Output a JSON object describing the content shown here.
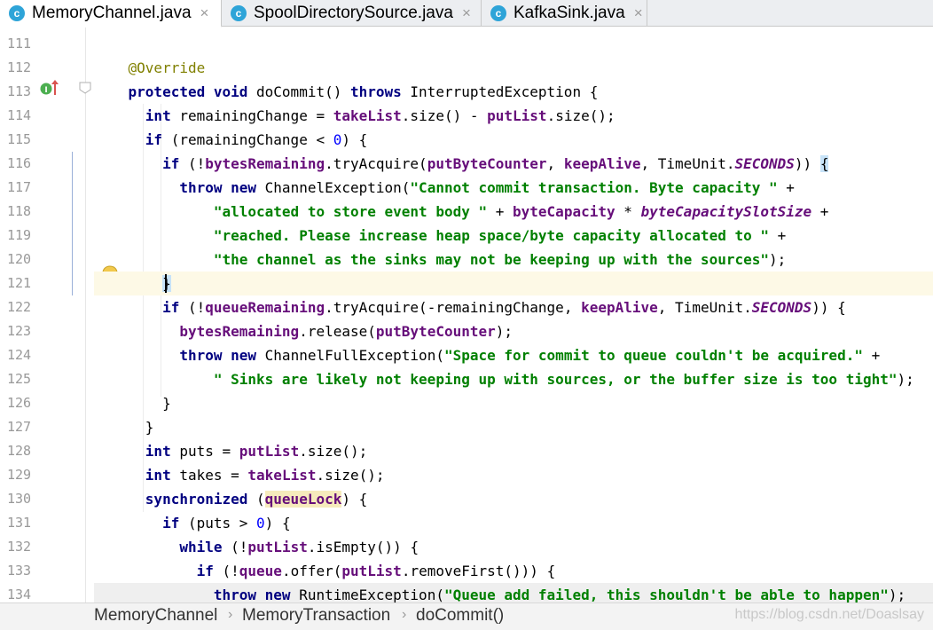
{
  "tabs": [
    {
      "label": "MemoryChannel.java",
      "active": true,
      "close": "×"
    },
    {
      "label": "SpoolDirectorySource.java",
      "active": false,
      "close": "×"
    },
    {
      "label": "KafkaSink.java",
      "active": false,
      "close": "×"
    }
  ],
  "tab_icon_letter": "c",
  "editor": {
    "line_numbers": [
      "111",
      "112",
      "113",
      "114",
      "115",
      "116",
      "117",
      "118",
      "119",
      "120",
      "121",
      "122",
      "123",
      "124",
      "125",
      "126",
      "127",
      "128",
      "129",
      "130",
      "131",
      "132",
      "133",
      "134"
    ],
    "lines": [
      [],
      [
        {
          "t": "    "
        },
        {
          "t": "@Override",
          "c": "ann"
        }
      ],
      [
        {
          "t": "    "
        },
        {
          "t": "protected void",
          "c": "kw"
        },
        {
          "t": " doCommit() "
        },
        {
          "t": "throws",
          "c": "kw"
        },
        {
          "t": " InterruptedException {"
        }
      ],
      [
        {
          "t": "      "
        },
        {
          "t": "int",
          "c": "kw"
        },
        {
          "t": " remainingChange = "
        },
        {
          "t": "takeList",
          "c": "fld"
        },
        {
          "t": ".size() - "
        },
        {
          "t": "putList",
          "c": "fld"
        },
        {
          "t": ".size();"
        }
      ],
      [
        {
          "t": "      "
        },
        {
          "t": "if",
          "c": "kw"
        },
        {
          "t": " (remainingChange < "
        },
        {
          "t": "0",
          "c": "num"
        },
        {
          "t": ") {"
        }
      ],
      [
        {
          "t": "        "
        },
        {
          "t": "if",
          "c": "kw"
        },
        {
          "t": " (!"
        },
        {
          "t": "bytesRemaining",
          "c": "fld"
        },
        {
          "t": ".tryAcquire("
        },
        {
          "t": "putByteCounter",
          "c": "fld"
        },
        {
          "t": ", "
        },
        {
          "t": "keepAlive",
          "c": "fld"
        },
        {
          "t": ", TimeUnit."
        },
        {
          "t": "SECONDS",
          "c": "st"
        },
        {
          "t": ")) "
        },
        {
          "t": "{",
          "c": "bracehl"
        }
      ],
      [
        {
          "t": "          "
        },
        {
          "t": "throw new",
          "c": "kw"
        },
        {
          "t": " ChannelException("
        },
        {
          "t": "\"Cannot commit transaction. Byte capacity \"",
          "c": "str"
        },
        {
          "t": " +"
        }
      ],
      [
        {
          "t": "              "
        },
        {
          "t": "\"allocated to store event body \"",
          "c": "str"
        },
        {
          "t": " + "
        },
        {
          "t": "byteCapacity",
          "c": "fld"
        },
        {
          "t": " * "
        },
        {
          "t": "byteCapacitySlotSize",
          "c": "st"
        },
        {
          "t": " +"
        }
      ],
      [
        {
          "t": "              "
        },
        {
          "t": "\"reached. Please increase heap space/byte capacity allocated to \"",
          "c": "str"
        },
        {
          "t": " +"
        }
      ],
      [
        {
          "t": "              "
        },
        {
          "t": "\"the channel as the sinks may not be keeping up with the sources\"",
          "c": "str"
        },
        {
          "t": ");"
        }
      ],
      [
        {
          "t": "        "
        },
        {
          "t": "}",
          "c": "bracehl"
        }
      ],
      [
        {
          "t": "        "
        },
        {
          "t": "if",
          "c": "kw"
        },
        {
          "t": " (!"
        },
        {
          "t": "queueRemaining",
          "c": "fld"
        },
        {
          "t": ".tryAcquire(-remainingChange, "
        },
        {
          "t": "keepAlive",
          "c": "fld"
        },
        {
          "t": ", TimeUnit."
        },
        {
          "t": "SECONDS",
          "c": "st"
        },
        {
          "t": ")) {"
        }
      ],
      [
        {
          "t": "          "
        },
        {
          "t": "bytesRemaining",
          "c": "fld"
        },
        {
          "t": ".release("
        },
        {
          "t": "putByteCounter",
          "c": "fld"
        },
        {
          "t": ");"
        }
      ],
      [
        {
          "t": "          "
        },
        {
          "t": "throw new",
          "c": "kw"
        },
        {
          "t": " ChannelFullException("
        },
        {
          "t": "\"Space for commit to queue couldn't be acquired.\"",
          "c": "str"
        },
        {
          "t": " +"
        }
      ],
      [
        {
          "t": "              "
        },
        {
          "t": "\" Sinks are likely not keeping up with sources, or the buffer size is too tight\"",
          "c": "str"
        },
        {
          "t": ");"
        }
      ],
      [
        {
          "t": "        }"
        }
      ],
      [
        {
          "t": "      }"
        }
      ],
      [
        {
          "t": "      "
        },
        {
          "t": "int",
          "c": "kw"
        },
        {
          "t": " puts = "
        },
        {
          "t": "putList",
          "c": "fld"
        },
        {
          "t": ".size();"
        }
      ],
      [
        {
          "t": "      "
        },
        {
          "t": "int",
          "c": "kw"
        },
        {
          "t": " takes = "
        },
        {
          "t": "takeList",
          "c": "fld"
        },
        {
          "t": ".size();"
        }
      ],
      [
        {
          "t": "      "
        },
        {
          "t": "synchronized",
          "c": "kw"
        },
        {
          "t": " ("
        },
        {
          "t": "queueLock",
          "c": "fld hlword"
        },
        {
          "t": ") {"
        }
      ],
      [
        {
          "t": "        "
        },
        {
          "t": "if",
          "c": "kw"
        },
        {
          "t": " (puts > "
        },
        {
          "t": "0",
          "c": "num"
        },
        {
          "t": ") {"
        }
      ],
      [
        {
          "t": "          "
        },
        {
          "t": "while",
          "c": "kw"
        },
        {
          "t": " (!"
        },
        {
          "t": "putList",
          "c": "fld"
        },
        {
          "t": ".isEmpty()) {"
        }
      ],
      [
        {
          "t": "            "
        },
        {
          "t": "if",
          "c": "kw"
        },
        {
          "t": " (!"
        },
        {
          "t": "queue",
          "c": "fld"
        },
        {
          "t": ".offer("
        },
        {
          "t": "putList",
          "c": "fld"
        },
        {
          "t": ".removeFirst())) {"
        }
      ],
      [
        {
          "t": "              "
        },
        {
          "t": "throw new",
          "c": "kw"
        },
        {
          "t": " RuntimeException("
        },
        {
          "t": "\"Queue add failed, this shouldn't be able to happen\"",
          "c": "str"
        },
        {
          "t": ");"
        }
      ]
    ]
  },
  "gutter_icons": {
    "override": "implementing-method-icon",
    "bulb": "lightbulb-icon",
    "fold": "fold-marker-icon"
  },
  "breadcrumb": {
    "items": [
      "MemoryChannel",
      "MemoryTransaction",
      "doCommit()"
    ],
    "separator": "›"
  },
  "watermark": "https://blog.csdn.net/Doaslsay"
}
